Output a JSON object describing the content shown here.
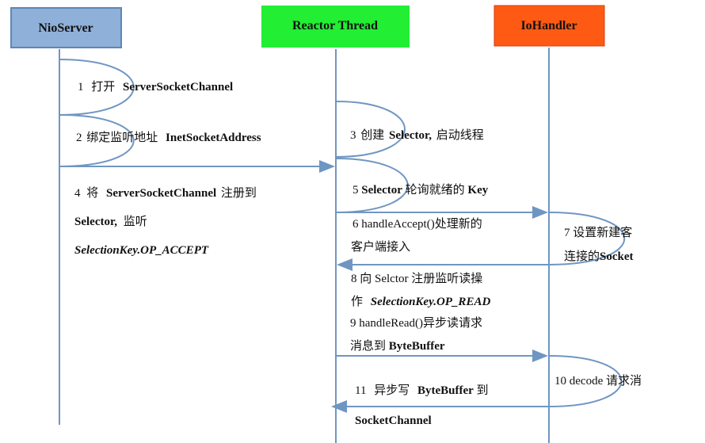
{
  "participants": [
    {
      "name": "NioServer",
      "color": "#8fb0d8"
    },
    {
      "name": "Reactor Thread",
      "color": "#22ee33"
    },
    {
      "name": "IoHandler",
      "color": "#ff5a14"
    }
  ],
  "steps": {
    "s1": {
      "num": "1",
      "cn": "打开",
      "en": "ServerSocketChannel"
    },
    "s2": {
      "num": "2",
      "cn": "绑定监听地址",
      "en": "InetSocketAddress"
    },
    "s3": {
      "num": "3",
      "cn1": "创建",
      "en": "Selector,",
      "cn2": "启动线程"
    },
    "s4": {
      "num": "4",
      "cn1": "将",
      "en1": "ServerSocketChannel",
      "cn2": "注册到",
      "en2": "Selector,",
      "cn3": "监听",
      "en3": "SelectionKey.OP_ACCEPT"
    },
    "s5": {
      "num": "5",
      "en1": "Selector",
      "cn": "轮询就绪的",
      "en2": "Key"
    },
    "s6": {
      "line1": "6 handleAccept()处理新的",
      "line2": "客户端接入"
    },
    "s7": {
      "line1": "7 设置新建客",
      "cn": "连接的",
      "en": "Socket"
    },
    "s8": {
      "line1": "8 向 Selctor 注册监听读操",
      "cn": "作",
      "en": "SelectionKey.OP_READ"
    },
    "s9": {
      "line1": "9 handleRead()异步读请求",
      "cn": "消息到",
      "en": "ByteBuffer"
    },
    "s10": {
      "text": "10 decode 请求消"
    },
    "s11": {
      "num": "11",
      "cn1": "异步写",
      "en": "ByteBuffer",
      "cn2": "到",
      "en2": "SocketChannel"
    }
  },
  "colors": {
    "line": "#6f96c2"
  }
}
